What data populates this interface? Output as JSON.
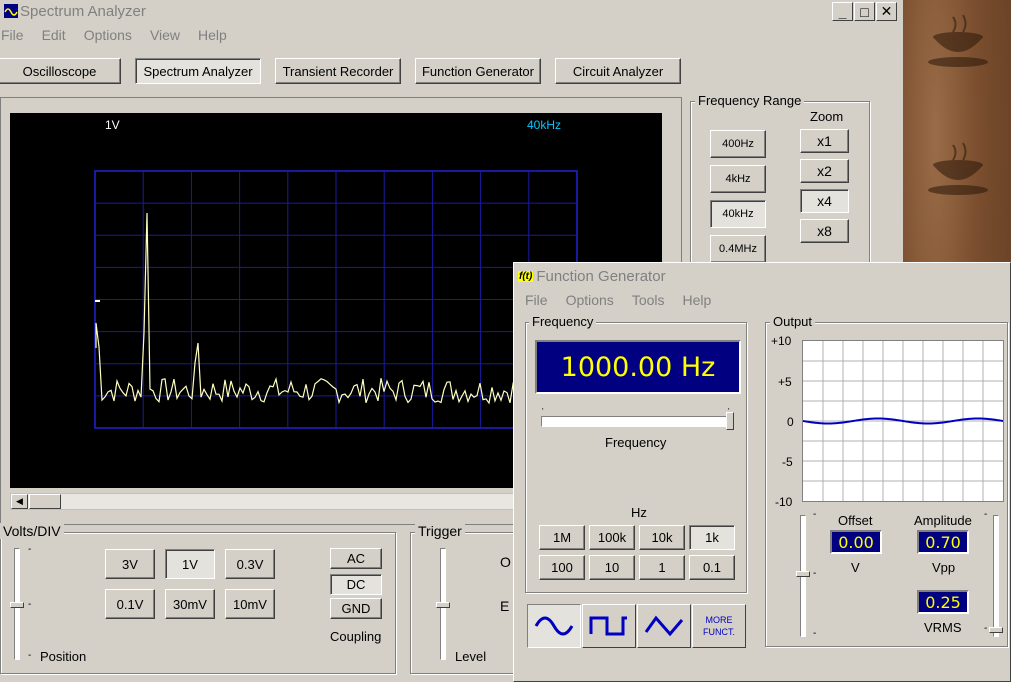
{
  "main_window": {
    "title": "Spectrum Analyzer",
    "menu": [
      "File",
      "Edit",
      "Options",
      "View",
      "Help"
    ],
    "window_buttons": [
      "_",
      "□",
      "✕"
    ],
    "instrument_tabs": [
      "Oscilloscope",
      "Spectrum Analyzer",
      "Transient Recorder",
      "Function Generator",
      "Circuit Analyzer"
    ],
    "active_tab": "Spectrum Analyzer",
    "screen": {
      "volts_readout": "1V",
      "freq_readout": "40kHz"
    },
    "frequency_range": {
      "label": "Frequency Range",
      "buttons": [
        "400Hz",
        "4kHz",
        "40kHz",
        "0.4MHz"
      ],
      "selected": "40kHz",
      "zoom_label": "Zoom",
      "zoom_buttons": [
        "x1",
        "x2",
        "x4",
        "x8"
      ],
      "zoom_selected": "x4"
    },
    "volts_div": {
      "label": "Volts/DIV",
      "buttons": [
        "3V",
        "1V",
        "0.3V",
        "0.1V",
        "30mV",
        "10mV"
      ],
      "selected": "1V",
      "position_label": "Position",
      "coupling_buttons": [
        "AC",
        "DC",
        "GND"
      ],
      "coupling_selected": "DC",
      "coupling_label": "Coupling"
    },
    "trigger": {
      "label": "Trigger",
      "level_label": "Level",
      "partial_O": "O",
      "partial_E": "E"
    }
  },
  "function_generator": {
    "title": "Function Generator",
    "icon_text": "f(t)",
    "menu": [
      "File",
      "Options",
      "Tools",
      "Help"
    ],
    "frequency": {
      "group_label": "Frequency",
      "display": "1000.00 Hz",
      "slider_label": "Frequency",
      "hz_label": "Hz",
      "buttons_row1": [
        "1M",
        "100k",
        "10k",
        "1k"
      ],
      "buttons_row2": [
        "100",
        "10",
        "1",
        "0.1"
      ],
      "selected": "1k"
    },
    "waveforms": {
      "buttons": [
        "sine",
        "square",
        "triangle"
      ],
      "selected": "sine",
      "more_line1": "MORE",
      "more_line2": "FUNCT."
    },
    "output": {
      "group_label": "Output",
      "y_labels": [
        "+10",
        "+5",
        "0",
        "-5",
        "-10"
      ],
      "offset_label": "Offset",
      "offset_value": "0.00",
      "offset_unit": "V",
      "amplitude_label": "Amplitude",
      "amplitude_value": "0.70",
      "amplitude_unit": "Vpp",
      "vrms_value": "0.25",
      "vrms_unit": "VRMS"
    }
  },
  "colors": {
    "screen_bg": "#000000",
    "grid": "#1a1aa0",
    "trace": "#ffffc0",
    "freq_readout": "#00c8ff",
    "display_bg": "#000080",
    "display_fg": "#ffff00",
    "wave_blue": "#0000c0"
  }
}
